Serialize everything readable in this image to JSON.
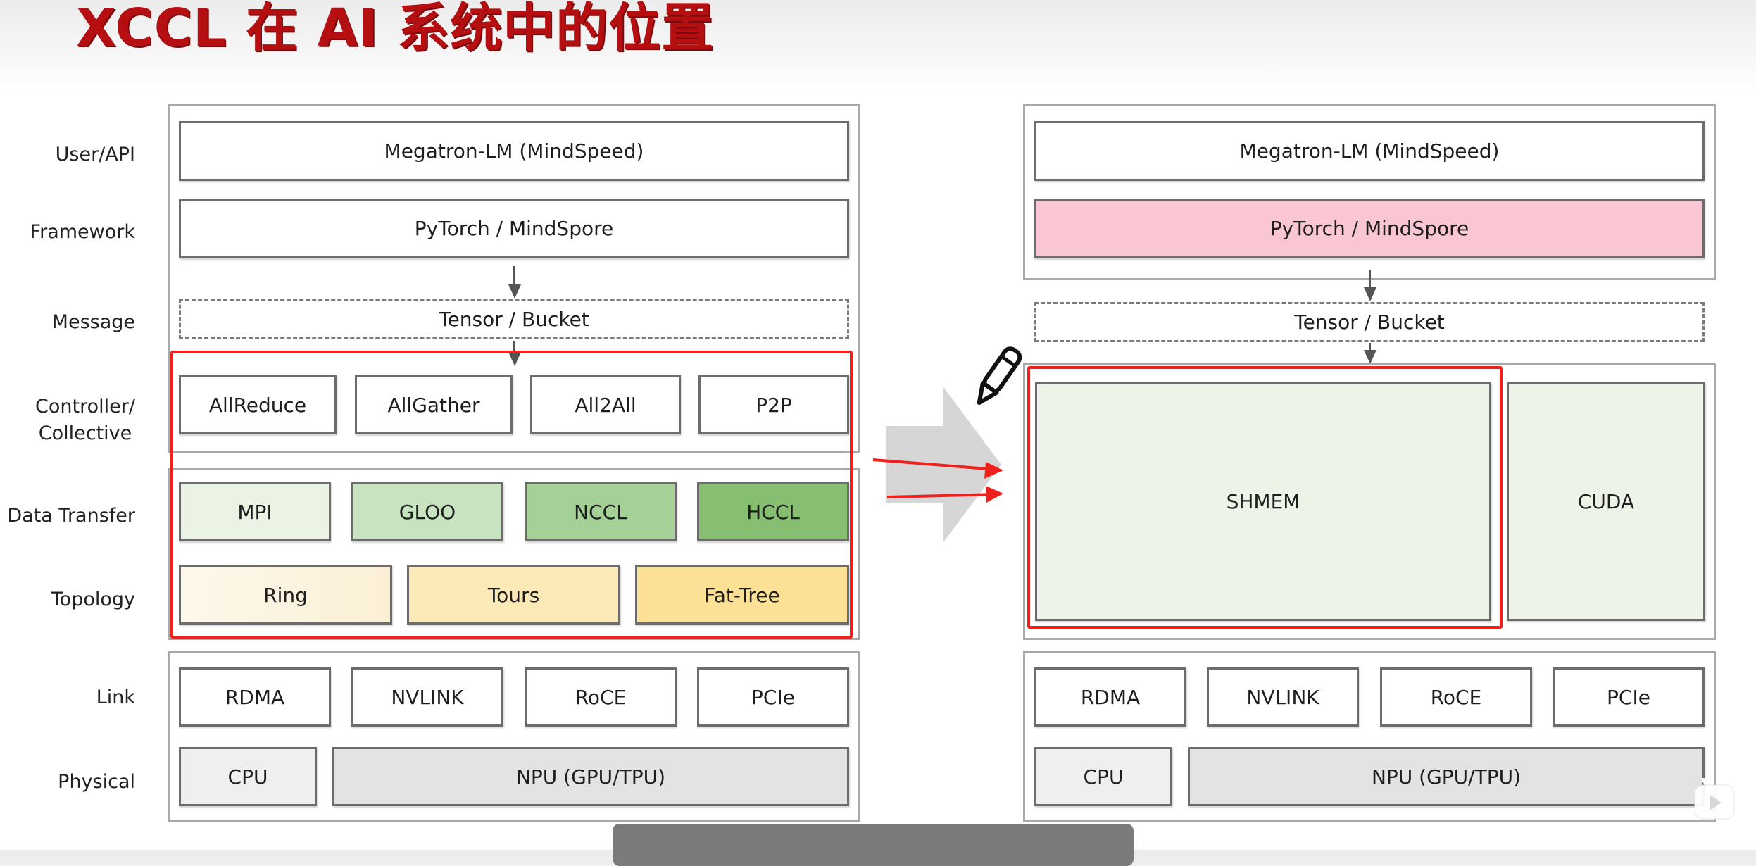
{
  "title": "XCCL 在 AI 系统中的位置",
  "layer_labels": [
    "User/API",
    "Framework",
    "Message",
    "Controller/",
    "Collective",
    "Data Transfer",
    "Topology",
    "Link",
    "Physical"
  ],
  "left_diagram": {
    "user_api": "Megatron-LM (MindSpeed)",
    "framework": "PyTorch / MindSpore",
    "message": "Tensor / Bucket",
    "collective": [
      "AllReduce",
      "AllGather",
      "All2All",
      "P2P"
    ],
    "data_transfer": [
      {
        "label": "MPI",
        "color": "#eaf3e4"
      },
      {
        "label": "GLOO",
        "color": "#c8e3bf"
      },
      {
        "label": "NCCL",
        "color": "#a5d196"
      },
      {
        "label": "HCCL",
        "color": "#86be72"
      }
    ],
    "topology": [
      {
        "label": "Ring",
        "color": "#fcf4e0"
      },
      {
        "label": "Tours",
        "color": "#fbeab8"
      },
      {
        "label": "Fat-Tree",
        "color": "#fbe095"
      }
    ],
    "link": [
      "RDMA",
      "NVLINK",
      "RoCE",
      "PCIe"
    ],
    "physical": [
      {
        "label": "CPU",
        "color": "#efefef"
      },
      {
        "label": "NPU (GPU/TPU)",
        "color": "#e3e3e3"
      }
    ]
  },
  "right_diagram": {
    "user_api": "Megatron-LM (MindSpeed)",
    "framework": {
      "label": "PyTorch / MindSpore",
      "color": "#fac6d3"
    },
    "message": "Tensor / Bucket",
    "middle": [
      {
        "label": "SHMEM",
        "color": "#edf4e7"
      },
      {
        "label": "CUDA",
        "color": "#edf4e7"
      }
    ],
    "link": [
      "RDMA",
      "NVLINK",
      "RoCE",
      "PCIe"
    ],
    "physical": [
      {
        "label": "CPU",
        "color": "#efefef"
      },
      {
        "label": "NPU (GPU/TPU)",
        "color": "#e3e3e3"
      }
    ]
  },
  "colors": {
    "title": "#b50f12",
    "highlight": "#f0201c",
    "big_arrow": "#d6d6d6"
  }
}
